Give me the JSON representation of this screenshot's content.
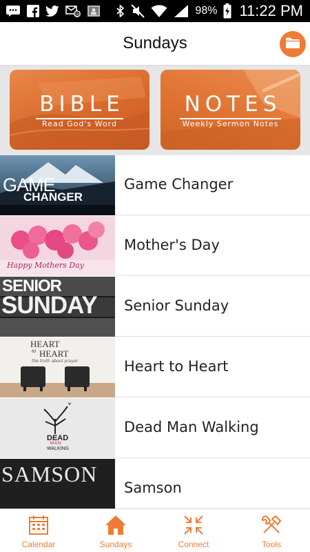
{
  "status_bar": {
    "battery_percent": "98%",
    "time": "11:22 PM",
    "icons": [
      "messages-icon",
      "facebook-icon",
      "twitter-icon",
      "email-icon",
      "photo-icon",
      "bluetooth-icon",
      "mute-icon",
      "wifi-icon",
      "signal-icon",
      "battery-charging-icon"
    ]
  },
  "header": {
    "title": "Sundays",
    "action_icon": "folder-icon"
  },
  "hero_tiles": [
    {
      "title": "BIBLE",
      "subtitle": "Read God's Word"
    },
    {
      "title": "NOTES",
      "subtitle": "Weekly Sermon Notes"
    }
  ],
  "sermons": [
    {
      "title": "Game Changer",
      "thumb_text": [
        "GAME",
        "CHANGER"
      ]
    },
    {
      "title": "Mother's Day",
      "thumb_text": [
        "Happy Mothers Day"
      ]
    },
    {
      "title": "Senior Sunday",
      "thumb_text": [
        "SENIOR",
        "SUNDAY"
      ]
    },
    {
      "title": "Heart to Heart",
      "thumb_text": [
        "HEART",
        "to",
        "HEART",
        "the truth about prayer"
      ]
    },
    {
      "title": "Dead Man Walking",
      "thumb_text": [
        "DEAD",
        "MAN",
        "WALKING"
      ]
    },
    {
      "title": "Samson",
      "thumb_text": [
        "SAMSON"
      ]
    }
  ],
  "tab_bar": {
    "tabs": [
      {
        "label": "Calendar",
        "icon": "calendar-icon"
      },
      {
        "label": "Sundays",
        "icon": "home-icon"
      },
      {
        "label": "Connect",
        "icon": "connect-arrows-icon"
      },
      {
        "label": "Tools",
        "icon": "tools-icon"
      }
    ]
  },
  "colors": {
    "accent": "#ef7b35",
    "status_bar": "#000000",
    "hero_background": "#e6e6e6"
  }
}
